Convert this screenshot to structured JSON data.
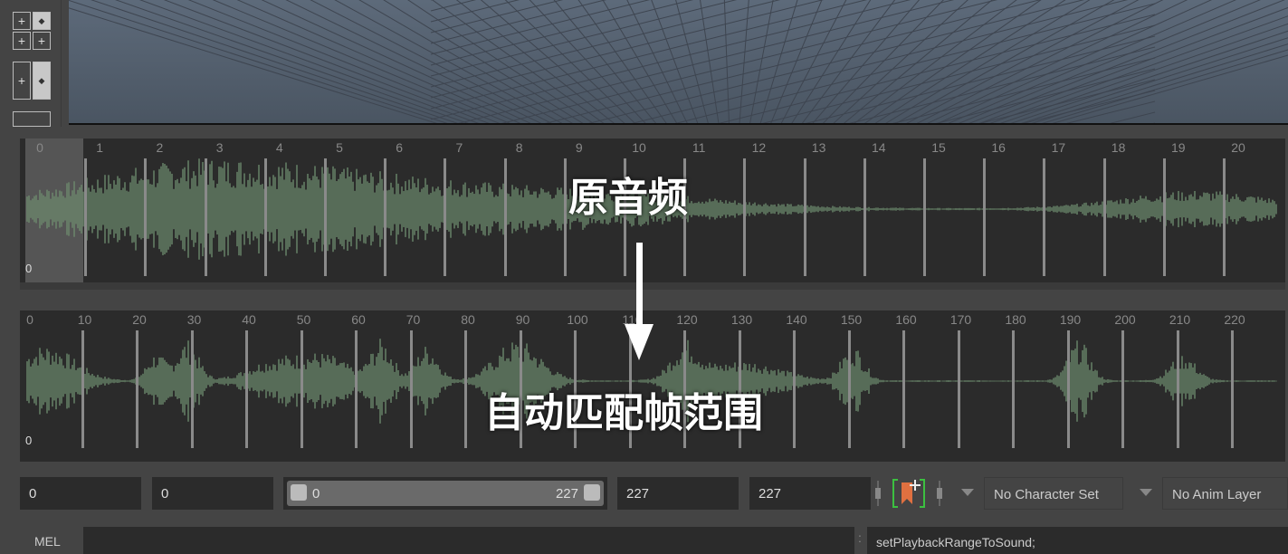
{
  "timeline_top": {
    "ticks": [
      "0",
      "1",
      "2",
      "3",
      "4",
      "5",
      "6",
      "7",
      "8",
      "9",
      "10",
      "11",
      "12",
      "13",
      "14",
      "15",
      "16",
      "17",
      "18",
      "19",
      "20"
    ],
    "current_frame": "0"
  },
  "timeline_bottom": {
    "ticks": [
      "0",
      "10",
      "20",
      "30",
      "40",
      "50",
      "60",
      "70",
      "80",
      "90",
      "100",
      "110",
      "120",
      "130",
      "140",
      "150",
      "160",
      "170",
      "180",
      "190",
      "200",
      "210",
      "220"
    ],
    "current_frame": "0"
  },
  "annotations": {
    "original_audio": "原音频",
    "auto_match": "自动匹配帧范围"
  },
  "range": {
    "start": "0",
    "playback_start": "0",
    "slider_start": "0",
    "slider_end": "227",
    "playback_end": "227",
    "end": "227"
  },
  "character_set": "No Character Set",
  "anim_layer": "No Anim Layer",
  "mel": {
    "label": "MEL",
    "input": "",
    "result": "setPlaybackRangeToSound;"
  },
  "colors": {
    "waveform": "#6f8f70",
    "key_icon": "#e07040",
    "bracket": "#3cc040"
  }
}
